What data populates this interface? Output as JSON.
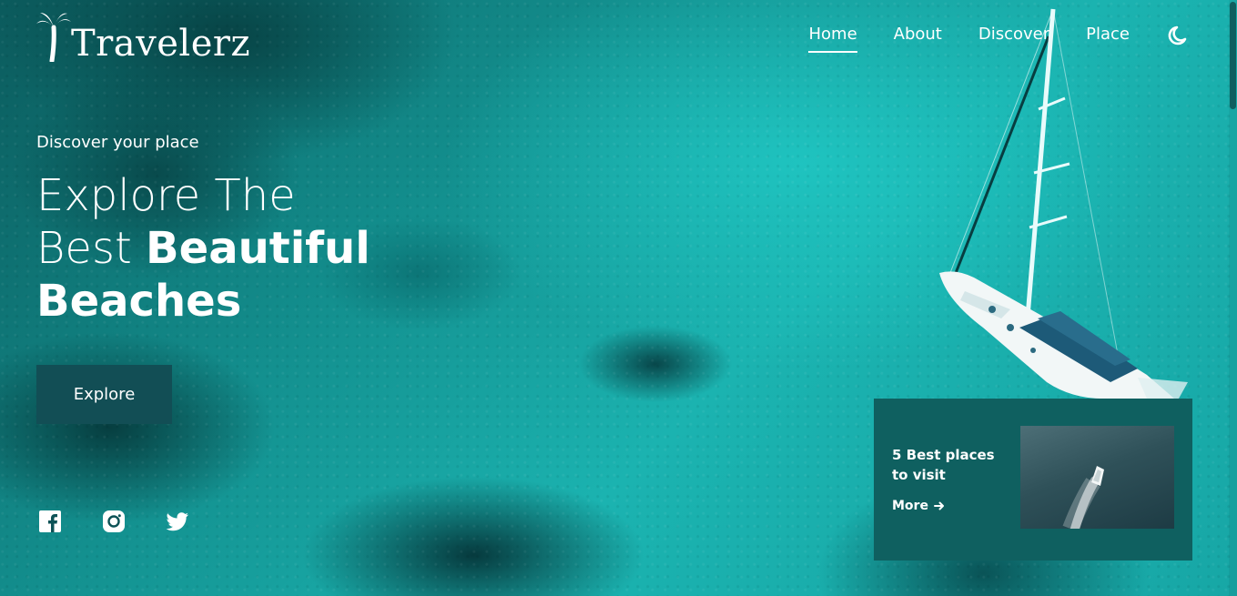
{
  "brand": {
    "logo_text": "Travelerz"
  },
  "nav": {
    "items": [
      {
        "label": "Home",
        "active": true
      },
      {
        "label": "About",
        "active": false
      },
      {
        "label": "Discover",
        "active": false
      },
      {
        "label": "Place",
        "active": false
      }
    ],
    "theme_icon": "moon-icon"
  },
  "hero": {
    "subtitle": "Discover your place",
    "title_line1": "Explore The",
    "title_line2_light": "Best ",
    "title_line2_bold": "Beautiful",
    "title_line3_bold": "Beaches",
    "cta_label": "Explore"
  },
  "socials": [
    {
      "icon": "facebook-icon"
    },
    {
      "icon": "instagram-icon"
    },
    {
      "icon": "twitter-icon"
    }
  ],
  "card": {
    "title": "5 Best places to visit",
    "more_label": "More",
    "more_icon": "arrow-right-icon"
  },
  "colors": {
    "accent": "#124e55",
    "card_bg": "#0f6060",
    "sea": "#1bb3b0"
  }
}
